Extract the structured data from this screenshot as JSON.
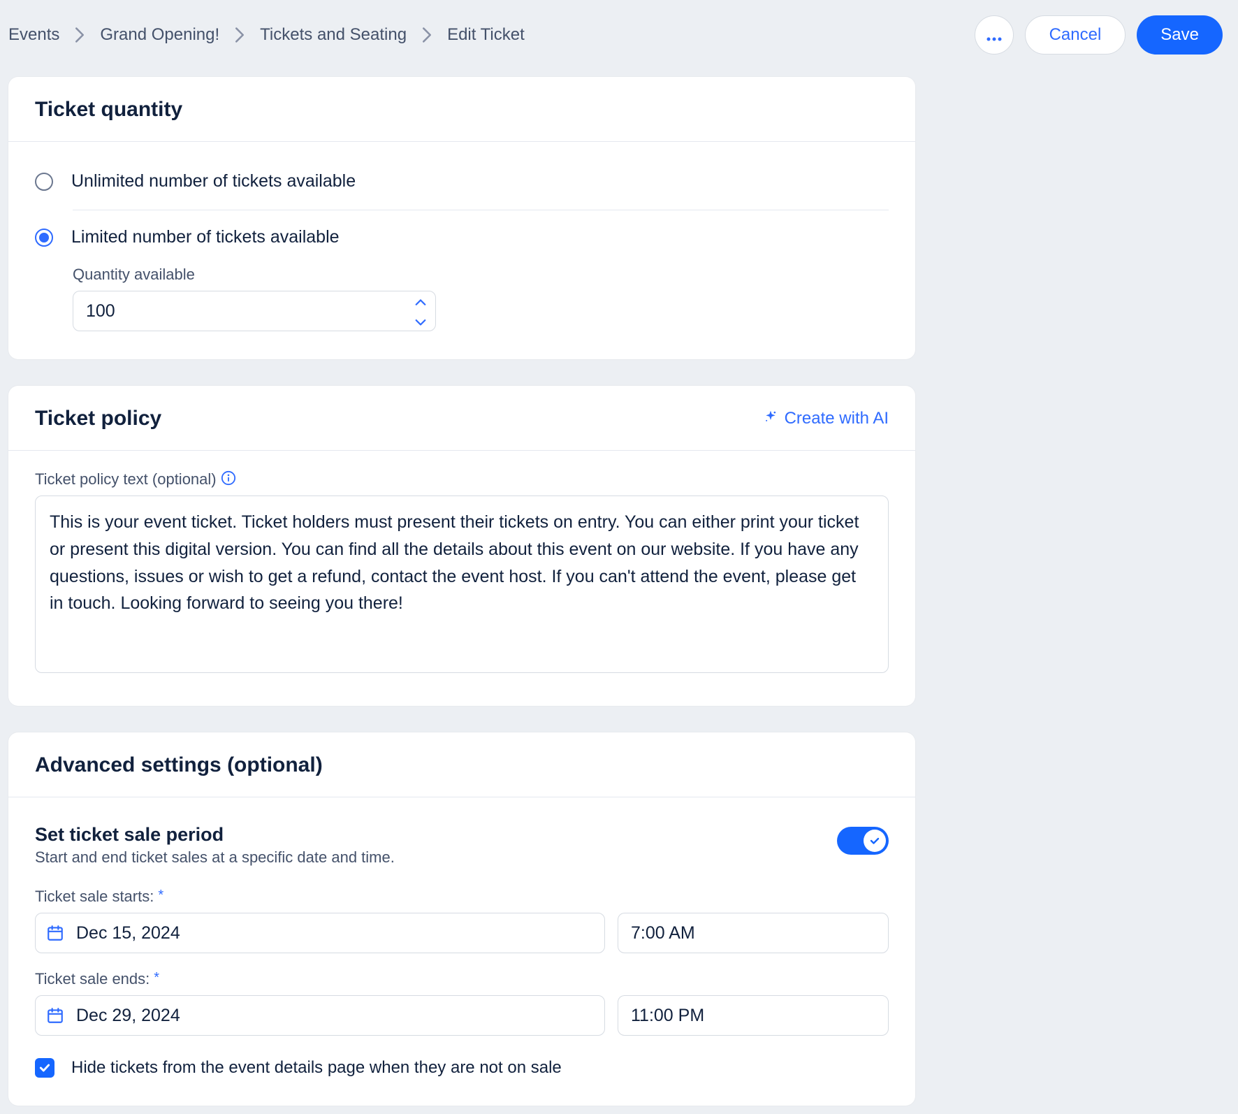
{
  "breadcrumb": {
    "items": [
      "Events",
      "Grand Opening!",
      "Tickets and Seating",
      "Edit Ticket"
    ]
  },
  "actions": {
    "cancel": "Cancel",
    "save": "Save"
  },
  "quantity": {
    "title": "Ticket quantity",
    "unlimited_label": "Unlimited number of tickets available",
    "limited_label": "Limited number of tickets available",
    "qty_label": "Quantity available",
    "qty_value": "100"
  },
  "policy": {
    "title": "Ticket policy",
    "create_ai": "Create with AI",
    "field_label": "Ticket policy text (optional)",
    "text": "This is your event ticket. Ticket holders must present their tickets on entry. You can either print your ticket or present this digital version. You can find all the details about this event on our website. If you have any questions, issues or wish to get a refund, contact the event host. If you can't attend the event, please get in touch. Looking forward to seeing you there!"
  },
  "advanced": {
    "title": "Advanced settings (optional)",
    "sale_period_title": "Set ticket sale period",
    "sale_period_sub": "Start and end ticket sales at a specific date and time.",
    "start_label": "Ticket sale starts:",
    "end_label": "Ticket sale ends:",
    "start_date": "Dec 15, 2024",
    "start_time": "7:00 AM",
    "end_date": "Dec 29, 2024",
    "end_time": "11:00 PM",
    "hide_label": "Hide tickets from the event details page when they are not on sale"
  }
}
